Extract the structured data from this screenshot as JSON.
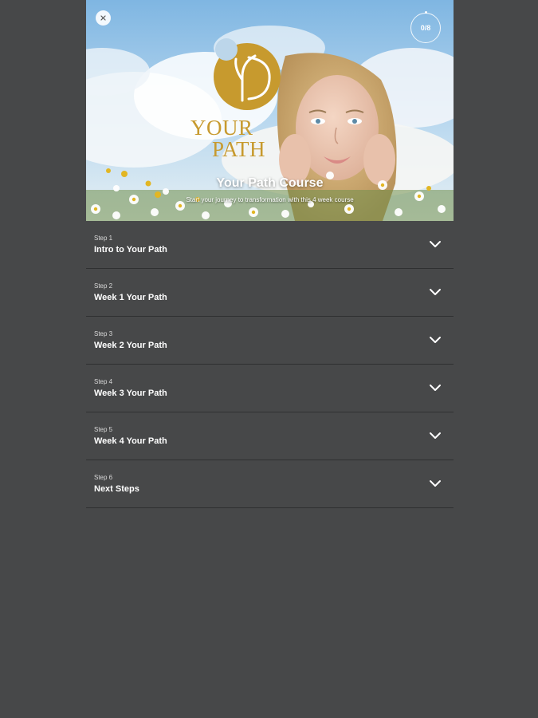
{
  "header": {
    "logo_line1": "YOUR",
    "logo_line2": "PATH",
    "title": "Your Path Course",
    "subtitle": "Start your journey to transformation with this 4 week course",
    "progress": "0/8"
  },
  "colors": {
    "background": "#474849",
    "logo_gold": "#c79a2e",
    "divider": "#2f3031"
  },
  "icons": {
    "close": "close-icon",
    "expand": "chevron-down-icon"
  },
  "steps": [
    {
      "number": "Step 1",
      "title": "Intro to Your Path"
    },
    {
      "number": "Step 2",
      "title": "Week 1 Your Path"
    },
    {
      "number": "Step 3",
      "title": "Week 2 Your Path"
    },
    {
      "number": "Step 4",
      "title": "Week 3 Your Path"
    },
    {
      "number": "Step 5",
      "title": "Week 4 Your Path"
    },
    {
      "number": "Step 6",
      "title": "Next Steps"
    }
  ]
}
